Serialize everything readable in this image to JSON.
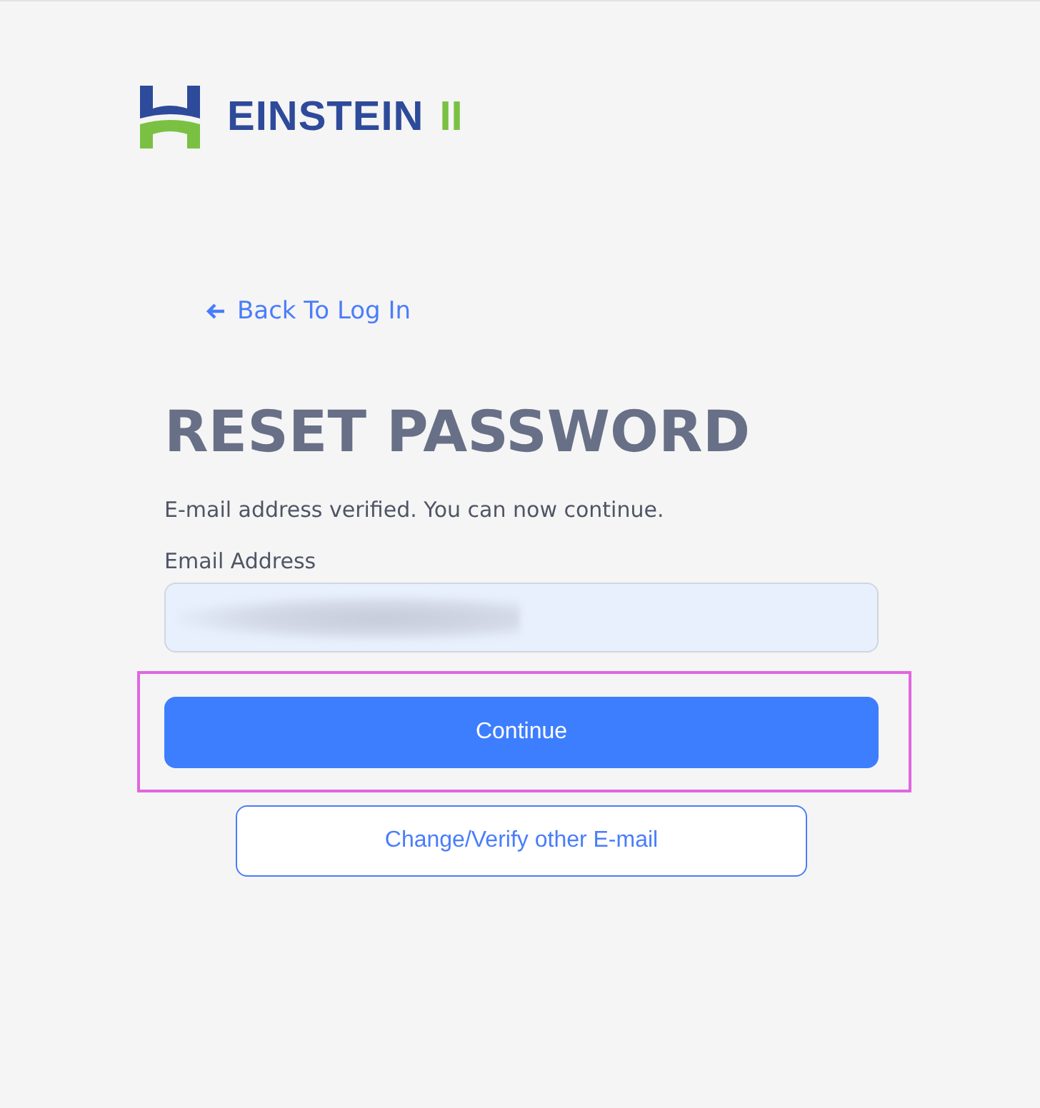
{
  "logo": {
    "name": "EINSTEIN",
    "suffix": "II"
  },
  "back_link": {
    "label": "Back To Log In"
  },
  "heading": "RESET PASSWORD",
  "message": "E-mail address verified. You can now continue.",
  "email_field": {
    "label": "Email Address",
    "redacted": true
  },
  "buttons": [
    {
      "kind": "primary",
      "label": "Continue",
      "highlighted": true
    },
    {
      "kind": "outline",
      "label": "Change/Verify other E-mail",
      "highlighted": false
    }
  ]
}
